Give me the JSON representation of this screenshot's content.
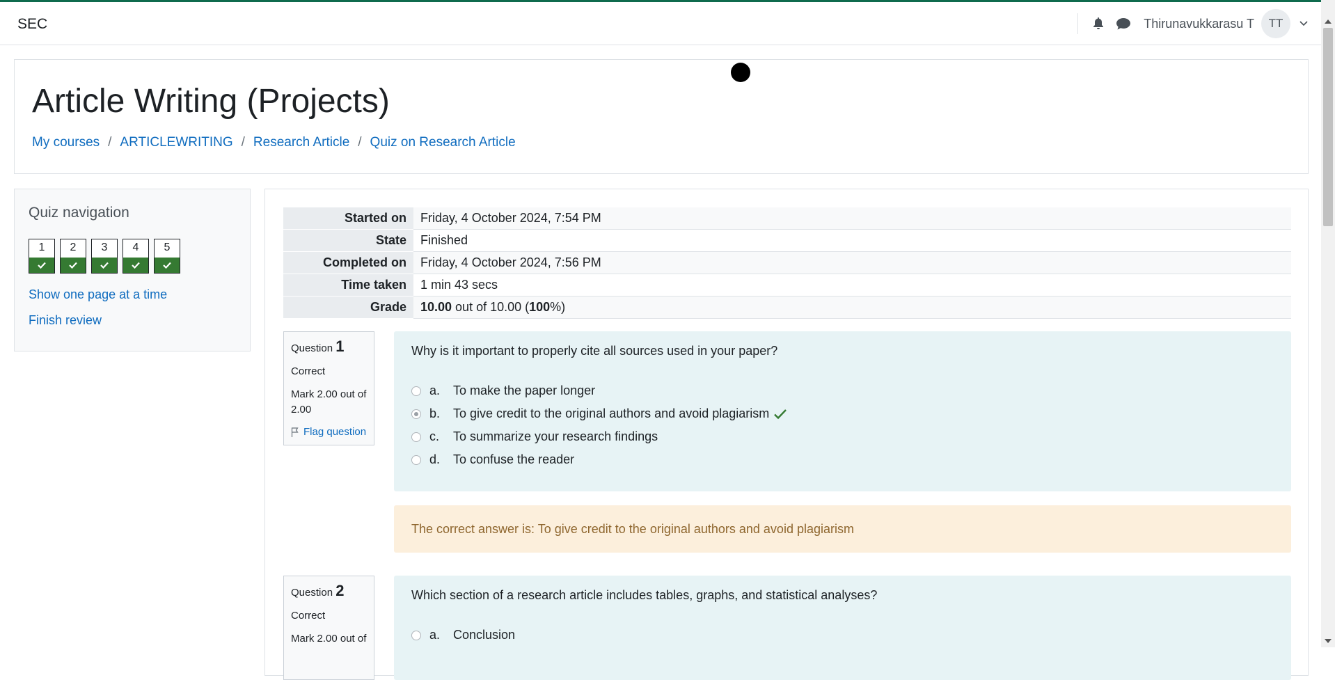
{
  "navbar": {
    "site_name": "SEC",
    "user_name": "Thirunavukkarasu T",
    "user_initials": "TT",
    "icons": [
      "bell-icon",
      "chat-icon",
      "chevron-down-icon"
    ]
  },
  "header": {
    "title": "Article Writing (Projects)",
    "breadcrumb": [
      "My courses",
      "ARTICLEWRITING",
      "Research Article",
      "Quiz on Research Article"
    ],
    "separator": "/"
  },
  "quiz_nav": {
    "title": "Quiz navigation",
    "buttons": [
      "1",
      "2",
      "3",
      "4",
      "5"
    ],
    "show_one_page": "Show one page at a time",
    "finish_review": "Finish review",
    "correct_color": "#357a32"
  },
  "summary": {
    "rows": [
      {
        "label": "Started on",
        "value": "Friday, 4 October 2024, 7:54 PM"
      },
      {
        "label": "State",
        "value": "Finished"
      },
      {
        "label": "Completed on",
        "value": "Friday, 4 October 2024, 7:56 PM"
      },
      {
        "label": "Time taken",
        "value": "1 min 43 secs"
      }
    ],
    "grade": {
      "label": "Grade",
      "score": "10.00",
      "out_of": " out of 10.00 (",
      "percent": "100",
      "suffix": "%)"
    }
  },
  "questions": [
    {
      "label": "Question",
      "number": "1",
      "state": "Correct",
      "mark": "Mark 2.00 out of 2.00",
      "flag": "Flag question",
      "text": "Why is it important to properly cite all sources used in your paper?",
      "answers": [
        {
          "letter": "a.",
          "text": "To make the paper longer"
        },
        {
          "letter": "b.",
          "text": "To give credit to the original authors and avoid plagiarism"
        },
        {
          "letter": "c.",
          "text": "To summarize your research findings"
        },
        {
          "letter": "d.",
          "text": "To confuse the reader"
        }
      ],
      "selected": "b.",
      "feedback": "The correct answer is: To give credit to the original authors and avoid plagiarism"
    },
    {
      "label": "Question",
      "number": "2",
      "state": "Correct",
      "mark": "Mark 2.00 out of",
      "text": "Which section of a research article includes tables, graphs, and statistical analyses?",
      "answers": [
        {
          "letter": "a.",
          "text": "Conclusion"
        }
      ]
    }
  ]
}
